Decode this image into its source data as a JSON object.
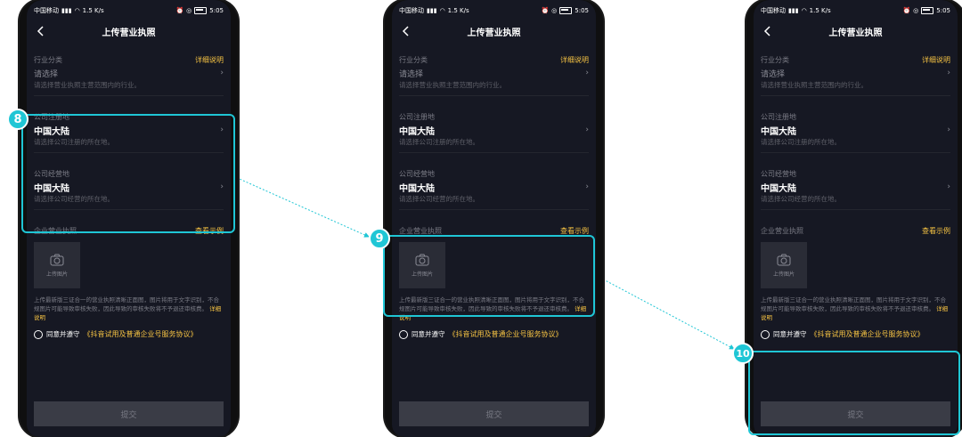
{
  "colors": {
    "accent": "#1fc6d5",
    "link": "#f6c343",
    "background": "#161823"
  },
  "steps": {
    "first": "8",
    "second": "9",
    "third": "10"
  },
  "screen": {
    "statusbar": {
      "carrier": "中国移动",
      "speed": "1.5 K/s",
      "time": "5:05"
    },
    "nav": {
      "title": "上传营业执照"
    },
    "industry": {
      "label": "行业分类",
      "detail_link": "详细说明",
      "value": "请选择",
      "hint": "请选择营业执照主营范围内的行业。"
    },
    "registered": {
      "label": "公司注册地",
      "value": "中国大陆",
      "hint": "请选择公司注册的所在地。"
    },
    "operating": {
      "label": "公司经营地",
      "value": "中国大陆",
      "hint": "请选择公司经营的所在地。"
    },
    "license": {
      "label": "企业营业执照",
      "example_link": "查看示例",
      "upload_label": "上传图片",
      "description": "上传最新版三证合一的营业执照清晰正面图，图片将用于文字识别，不合规图片可能导致审核失败，因此导致的审核失败将不予退还审核费。",
      "detail_link": "详细说明"
    },
    "agreement": {
      "prefix": "同意并遵守",
      "link": "《抖音试用及普通企业号服务协议》"
    },
    "submit": "提交",
    "icons": {
      "back": "chevron-left-icon",
      "camera": "camera-icon",
      "chevron": "chevron-right-icon",
      "radio": "radio-unchecked-icon"
    }
  }
}
